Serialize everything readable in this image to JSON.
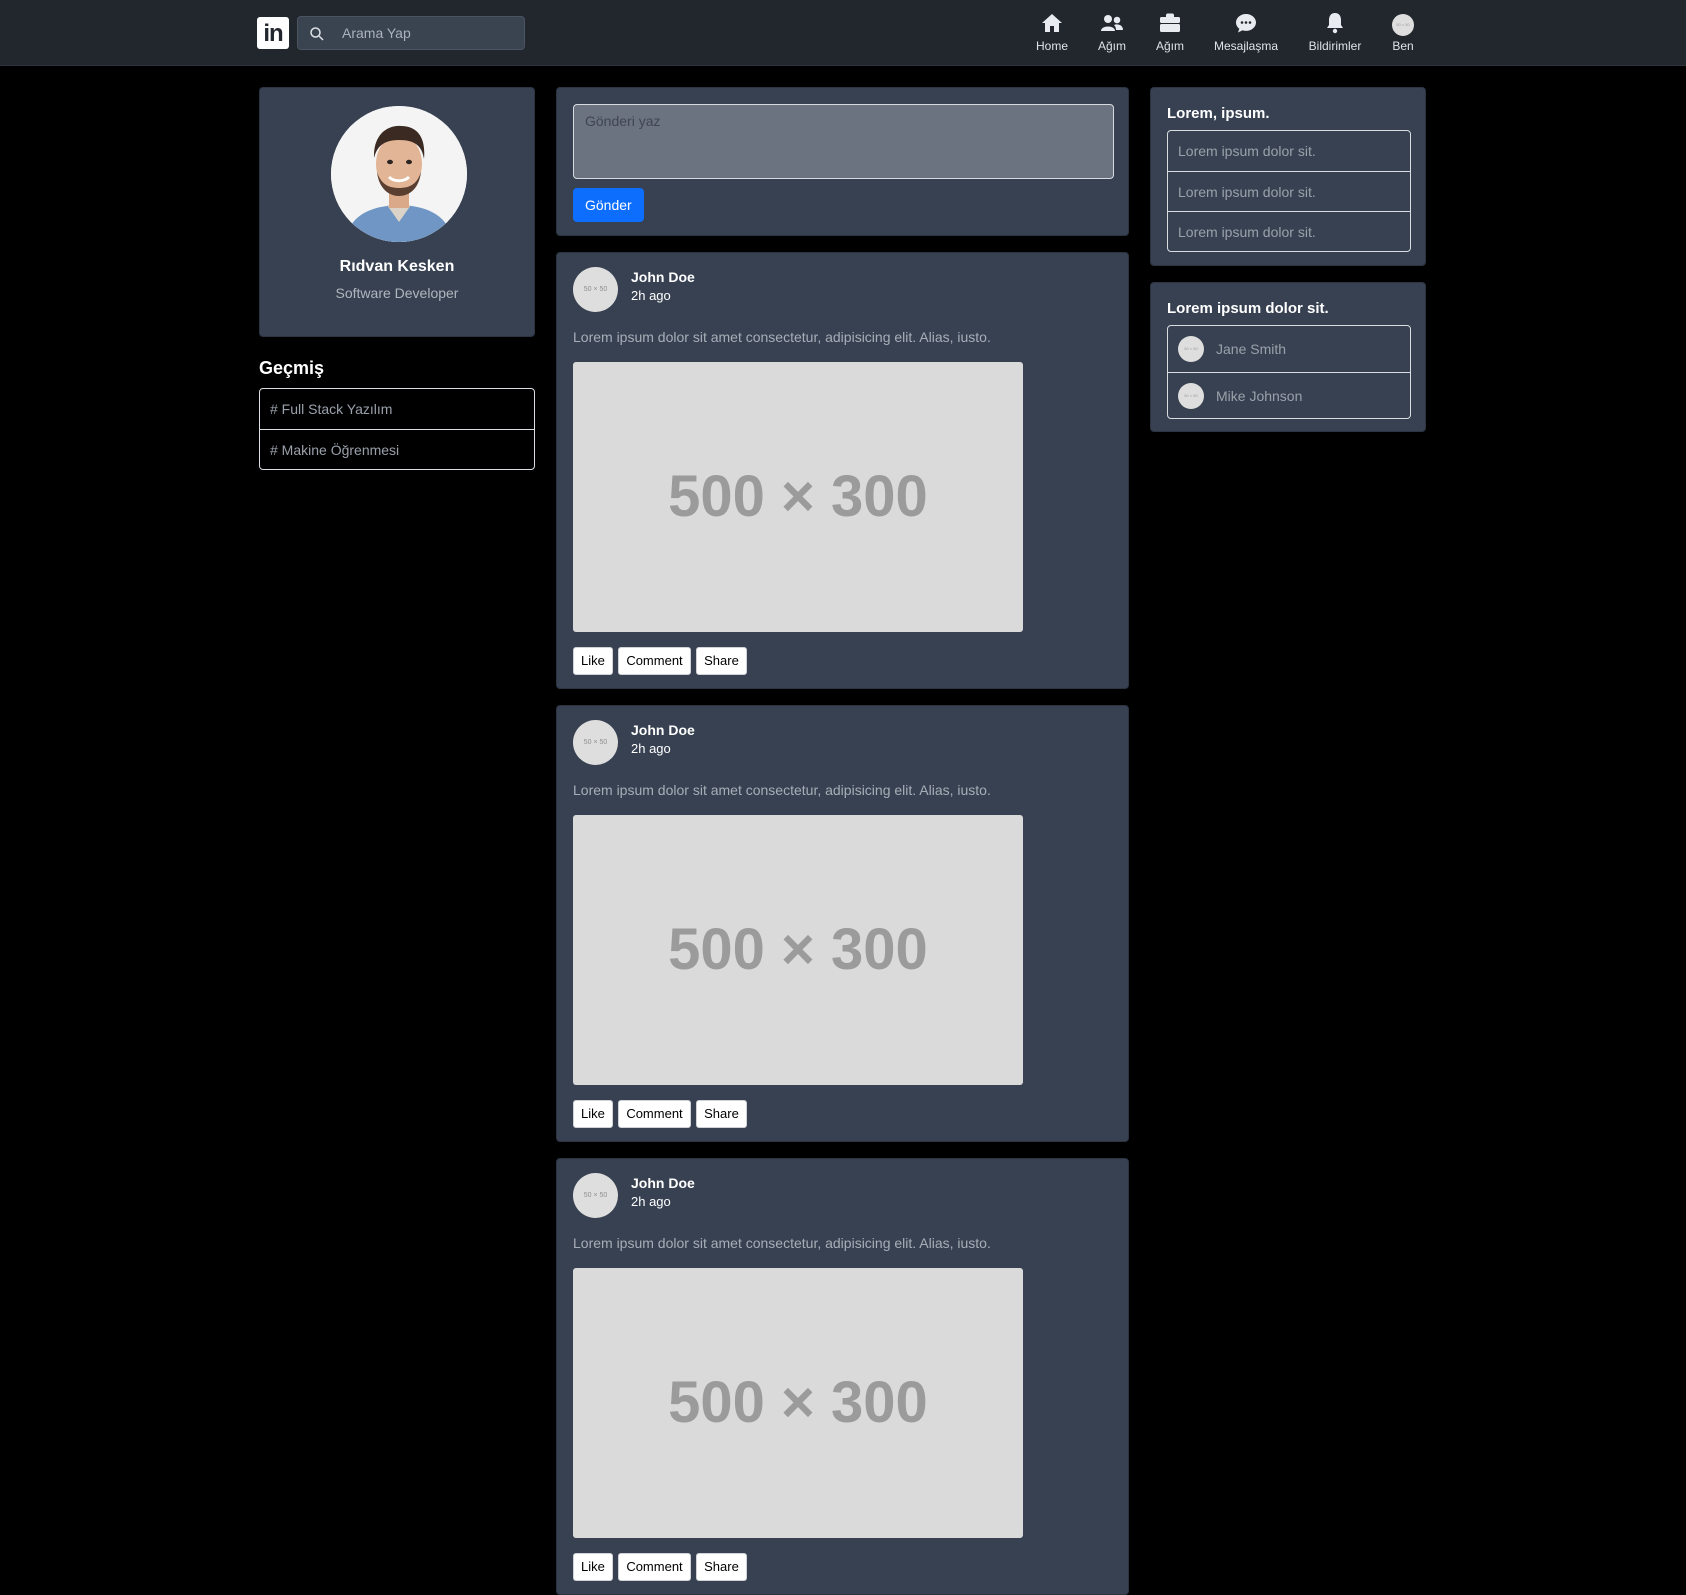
{
  "navbar": {
    "logo_text": "in",
    "search": {
      "placeholder": "Arama Yap",
      "value": ""
    },
    "items": [
      {
        "label": "Home",
        "icon": "home-icon"
      },
      {
        "label": "Ağım",
        "icon": "people-icon"
      },
      {
        "label": "Ağım",
        "icon": "briefcase-icon"
      },
      {
        "label": "Mesajlaşma",
        "icon": "chat-icon"
      },
      {
        "label": "Bildirimler",
        "icon": "bell-icon"
      },
      {
        "label": "Ben",
        "icon": "avatar"
      }
    ],
    "avatar_placeholder": "50 × 50"
  },
  "profile": {
    "name": "Rıdvan Kesken",
    "title": "Software Developer"
  },
  "history": {
    "title": "Geçmiş",
    "items": [
      "# Full Stack Yazılım",
      "# Makine Öğrenmesi"
    ]
  },
  "composer": {
    "placeholder": "Gönderi yaz",
    "value": "",
    "send_label": "Gönder"
  },
  "posts": [
    {
      "avatar_placeholder": "50 × 50",
      "author": "John Doe",
      "time": "2h ago",
      "text": "Lorem ipsum dolor sit amet consectetur, adipisicing elit. Alias, iusto.",
      "image_placeholder": "500 × 300",
      "actions": {
        "like": "Like",
        "comment": "Comment",
        "share": "Share"
      }
    },
    {
      "avatar_placeholder": "50 × 50",
      "author": "John Doe",
      "time": "2h ago",
      "text": "Lorem ipsum dolor sit amet consectetur, adipisicing elit. Alias, iusto.",
      "image_placeholder": "500 × 300",
      "actions": {
        "like": "Like",
        "comment": "Comment",
        "share": "Share"
      }
    },
    {
      "avatar_placeholder": "50 × 50",
      "author": "John Doe",
      "time": "2h ago",
      "text": "Lorem ipsum dolor sit amet consectetur, adipisicing elit. Alias, iusto.",
      "image_placeholder": "500 × 300",
      "actions": {
        "like": "Like",
        "comment": "Comment",
        "share": "Share"
      }
    }
  ],
  "right_card_1": {
    "title": "Lorem, ipsum.",
    "items": [
      "Lorem ipsum dolor sit.",
      "Lorem ipsum dolor sit.",
      "Lorem ipsum dolor sit."
    ]
  },
  "right_card_2": {
    "title": "Lorem ipsum dolor sit.",
    "people": [
      {
        "name": "Jane Smith",
        "avatar_placeholder": "50 × 50"
      },
      {
        "name": "Mike Johnson",
        "avatar_placeholder": "50 × 50"
      }
    ]
  },
  "colors": {
    "page_bg": "#000000",
    "navbar_bg": "#22272e",
    "card_bg": "#374151",
    "primary_button": "#0d6efd"
  }
}
